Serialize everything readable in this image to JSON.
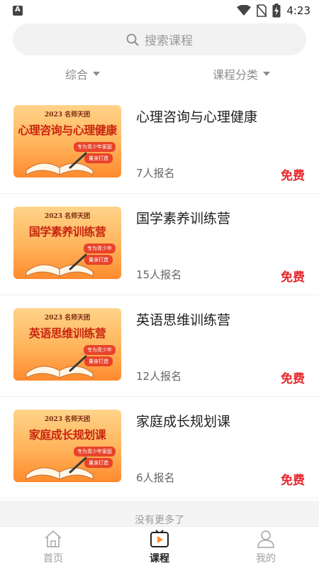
{
  "status": {
    "time": "4:23",
    "app_badge": "A"
  },
  "search": {
    "placeholder": "搜索课程"
  },
  "filters": [
    {
      "label": "综合"
    },
    {
      "label": "课程分类"
    }
  ],
  "courses": [
    {
      "title": "心理咨询与心理健康",
      "count": "7人报名",
      "price": "免费",
      "thumb": {
        "top": "2023 名师天团",
        "title": "心理咨询与心理健康",
        "tag1": "专为青少年家庭",
        "tag2": "量身打造"
      }
    },
    {
      "title": "国学素养训练营",
      "count": "15人报名",
      "price": "免费",
      "thumb": {
        "top": "2023 名师天团",
        "title": "国学素养训练营",
        "tag1": "专为青少年",
        "tag2": "量身打造"
      }
    },
    {
      "title": "英语思维训练营",
      "count": "12人报名",
      "price": "免费",
      "thumb": {
        "top": "2023 名师天团",
        "title": "英语思维训练营",
        "tag1": "专为青少年",
        "tag2": "量身打造"
      }
    },
    {
      "title": "家庭成长规划课",
      "count": "6人报名",
      "price": "免费",
      "thumb": {
        "top": "2023 名师天团",
        "title": "家庭成长规划课",
        "tag1": "专为青少年家庭",
        "tag2": "量身打造"
      }
    }
  ],
  "footer_note": "没有更多了",
  "tabs": [
    {
      "label": "首页",
      "icon": "home-icon",
      "active": false
    },
    {
      "label": "课程",
      "icon": "course-play-icon",
      "active": true
    },
    {
      "label": "我的",
      "icon": "profile-icon",
      "active": false
    }
  ],
  "colors": {
    "price": "#e8262b",
    "accent": "#ff8a2e"
  }
}
